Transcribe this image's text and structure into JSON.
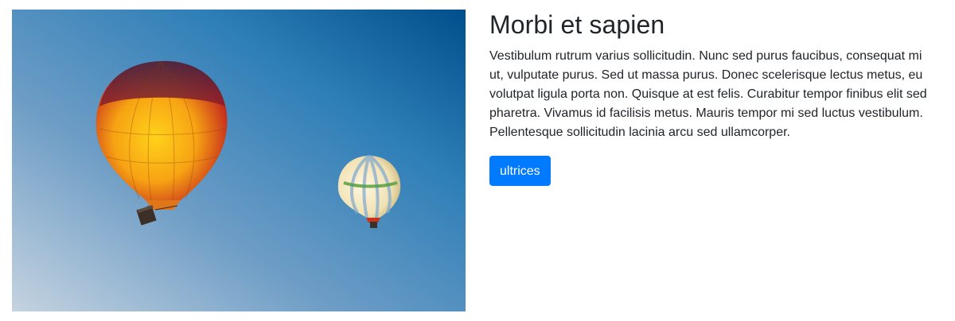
{
  "card": {
    "image_alt": "Two hot air balloons in a blue sky",
    "title": "Morbi et sapien",
    "body": "Vestibulum rutrum varius sollicitudin. Nunc sed purus faucibus, consequat mi ut, vulputate purus. Sed ut massa purus. Donec scelerisque lectus metus, eu volutpat ligula porta non. Quisque at est felis. Curabitur tempor finibus elit sed pharetra. Vivamus id facilisis metus. Mauris tempor mi sed luctus vestibulum. Pellentesque sollicitudin lacinia arcu sed ullamcorper.",
    "button_label": "ultrices"
  },
  "colors": {
    "button_bg": "#007bff",
    "text": "#212529",
    "sky_top": "#00508a",
    "sky_bottom": "#c9d6e2"
  }
}
